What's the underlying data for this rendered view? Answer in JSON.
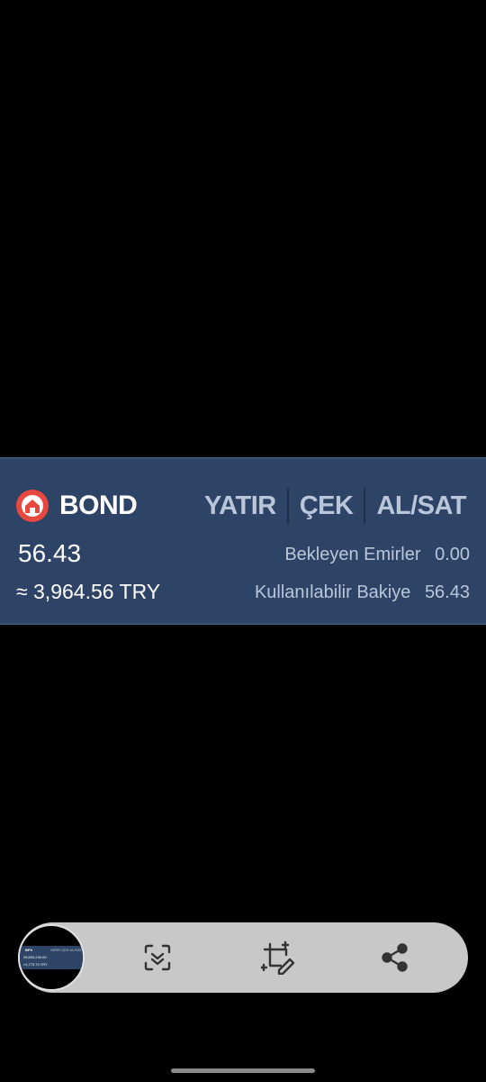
{
  "asset": {
    "symbol": "BOND",
    "icon": "bond-coin-icon",
    "icon_color": "#e8483f",
    "balance": "56.43",
    "approx_value": "≈ 3,964.56 TRY",
    "pending_orders_label": "Bekleyen Emirler",
    "pending_orders_value": "0.00",
    "available_label": "Kullanılabilir Bakiye",
    "available_value": "56.43"
  },
  "actions": {
    "deposit_label": "YATIR",
    "withdraw_label": "ÇEK",
    "trade_label": "AL/SAT"
  },
  "toolbar": {
    "thumbnail_texts": [
      "BPX",
      "VATIR  ÇEK  AL/SAT",
      "26,603,249.00",
      "≈1,773.74 TRY"
    ],
    "buttons": [
      {
        "name": "scroll-capture-icon"
      },
      {
        "name": "crop-edit-icon"
      },
      {
        "name": "share-icon"
      }
    ]
  },
  "colors": {
    "card_background": "#2e4466",
    "accent_text": "#b9c6d9",
    "toolbar_background": "#c8c8c8"
  }
}
